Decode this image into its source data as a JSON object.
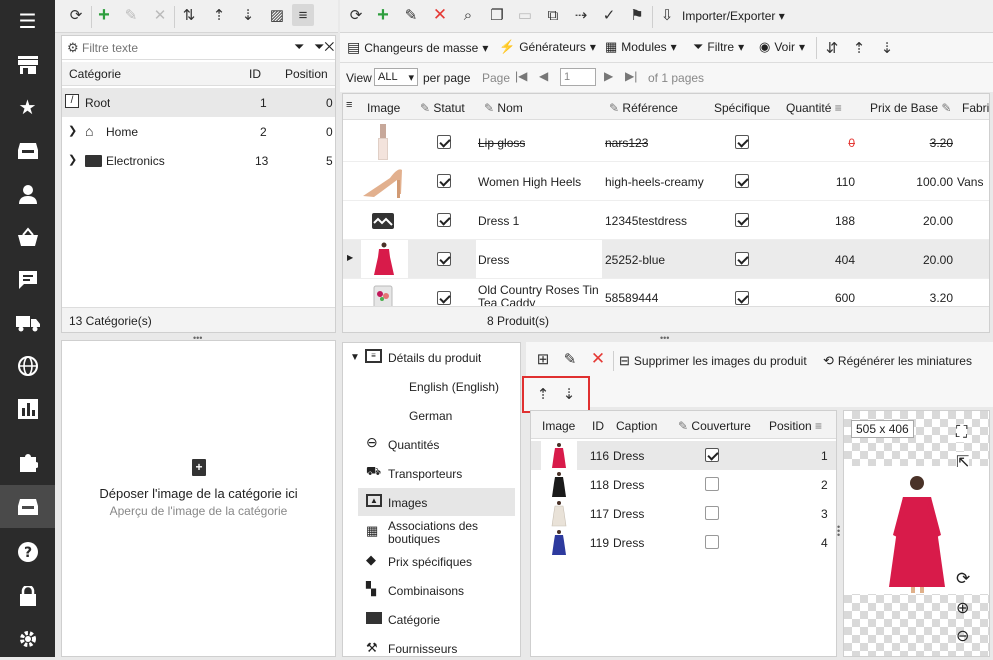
{
  "toolbar_left": {
    "filter_placeholder": "Filtre texte"
  },
  "toolbar_right": {
    "import_export": "Importer/Exporter"
  },
  "toolbar2": {
    "mass": "Changeurs de masse",
    "generators": "Générateurs",
    "modules": "Modules",
    "filter": "Filtre",
    "view": "Voir"
  },
  "pager": {
    "view_label": "View",
    "per_page_value": "ALL",
    "per_page_label": "per page",
    "page_label": "Page",
    "page_value": "1",
    "of_pages": "of 1 pages"
  },
  "categories": {
    "headers": {
      "name": "Catégorie",
      "id": "ID",
      "position": "Position"
    },
    "rows": [
      {
        "name": "Root",
        "id": "1",
        "position": "0"
      },
      {
        "name": "Home",
        "id": "2",
        "position": "0"
      },
      {
        "name": "Electronics",
        "id": "13",
        "position": "5"
      }
    ],
    "footer": "13 Catégorie(s)"
  },
  "dropzone": {
    "title": "Déposer l'image de la catégorie ici",
    "subtitle": "Aperçu de l'image de la catégorie"
  },
  "products": {
    "headers": {
      "image": "Image",
      "status": "Statut",
      "name": "Nom",
      "reference": "Référence",
      "specific": "Spécifique",
      "quantity": "Quantité",
      "base_price": "Prix de Base",
      "manufacturer": "Fabri"
    },
    "rows": [
      {
        "name": "Lip gloss",
        "reference": "nars123",
        "quantity": "0",
        "price": "3.20",
        "manufacturer": ""
      },
      {
        "name": "Women High Heels",
        "reference": "high-heels-creamy",
        "quantity": "110",
        "price": "100.00",
        "manufacturer": "Vans"
      },
      {
        "name": "Dress 1",
        "reference": "12345testdress",
        "quantity": "188",
        "price": "20.00",
        "manufacturer": ""
      },
      {
        "name": "Dress",
        "reference": "25252-blue",
        "quantity": "404",
        "price": "20.00",
        "manufacturer": ""
      },
      {
        "name": "Old Country Roses Tin Tea Caddy",
        "reference": "58589444",
        "quantity": "600",
        "price": "3.20",
        "manufacturer": ""
      }
    ],
    "footer": "8 Produit(s)"
  },
  "details_tree": {
    "root": "Détails du produit",
    "langs": [
      "English (English)",
      "German"
    ],
    "items": [
      "Quantités",
      "Transporteurs",
      "Images",
      "Associations des boutiques",
      "Prix spécifiques",
      "Combinaisons",
      "Catégorie",
      "Fournisseurs"
    ]
  },
  "images_toolbar": {
    "delete_images": "Supprimer les images du produit",
    "regenerate": "Régénérer les miniatures"
  },
  "images": {
    "headers": {
      "image": "Image",
      "id": "ID",
      "caption": "Caption",
      "cover": "Couverture",
      "position": "Position"
    },
    "rows": [
      {
        "id": "116",
        "caption": "Dress",
        "cover": true,
        "position": "1"
      },
      {
        "id": "118",
        "caption": "Dress",
        "cover": false,
        "position": "2"
      },
      {
        "id": "117",
        "caption": "Dress",
        "cover": false,
        "position": "3"
      },
      {
        "id": "119",
        "caption": "Dress",
        "cover": false,
        "position": "4"
      }
    ]
  },
  "preview": {
    "size": "505 x 406"
  },
  "colors": {
    "sidebar": "#2b2b2b",
    "highlight_box": "#e03030",
    "delete_red": "#e53935",
    "add_green": "#2e9e3e",
    "dress_red": "#d81b4a"
  }
}
